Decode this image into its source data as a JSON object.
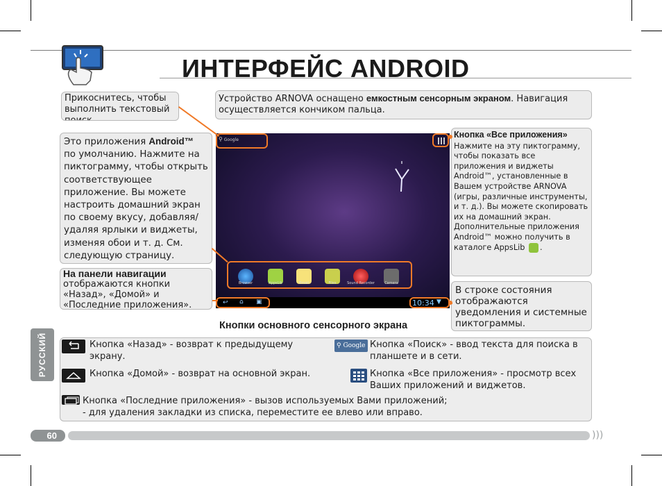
{
  "page": {
    "title": "ИНТЕРФЕЙС ANDROID",
    "page_number": "60",
    "side_tab": "РУССКИЙ",
    "caption": "Кнопки основного сенсорного экрана"
  },
  "callouts": {
    "search": "Прикоснитесь, чтобы выполнить текстовый поиск",
    "device_pre": "Устройство ARNOVA оснащено ",
    "device_bold": "емкостным сенсорным экраном",
    "device_post": ". Навигация осуществляется кончиком пальца.",
    "apps_pre": "Это приложения ",
    "apps_bold": "Android™",
    "apps_post": " по умолчанию. Нажмите на пиктограмму, чтобы открыть соответствующее приложение. Вы можете настроить домашний экран по своему вкусу, добавляя/ удаляя ярлыки и виджеты, изменяя обои и т. д. См. следующую страницу.",
    "nav_bold": "На панели навигации",
    "nav_text": "отображаются кнопки «Назад», «Домой» и «Последние приложения».",
    "all_apps_title": "Кнопка «Все приложения»",
    "all_apps_text": "Нажмите на эту пиктограмму, чтобы показать все приложения и виджеты Android™, установленные в Вашем устройстве ARNOVA (игры, различные инструменты, и т. д.). Вы можете скопировать их на домашний экран. Дополнительные приложения Android™ можно получить в каталоге AppsLib",
    "all_apps_end": ".",
    "status": "В строке состояния отображаются уведомления и системные пиктограммы."
  },
  "screen": {
    "search_label": "Google",
    "clock": "10:34",
    "apps": [
      "Browser",
      "AppsLib",
      "Email",
      "Files",
      "Sound Recorder",
      "Camera"
    ]
  },
  "legend": {
    "back": "Кнопка «Назад» - возврат к предыдущему экрану.",
    "home": "Кнопка «Домой» - возврат на основной экран.",
    "recent_1": "Кнопка «Последние приложения» - вызов используемых Вами приложений;",
    "recent_2": "- для удаления закладки из списка, переместите ее влево или вправо.",
    "search": "Кнопка «Поиск» -  ввод текста для поиска в планшете и в сети.",
    "search_icon_label": "Google",
    "all_apps": "Кнопка «Все приложения» - просмотр всех Ваших приложений и виджетов."
  }
}
